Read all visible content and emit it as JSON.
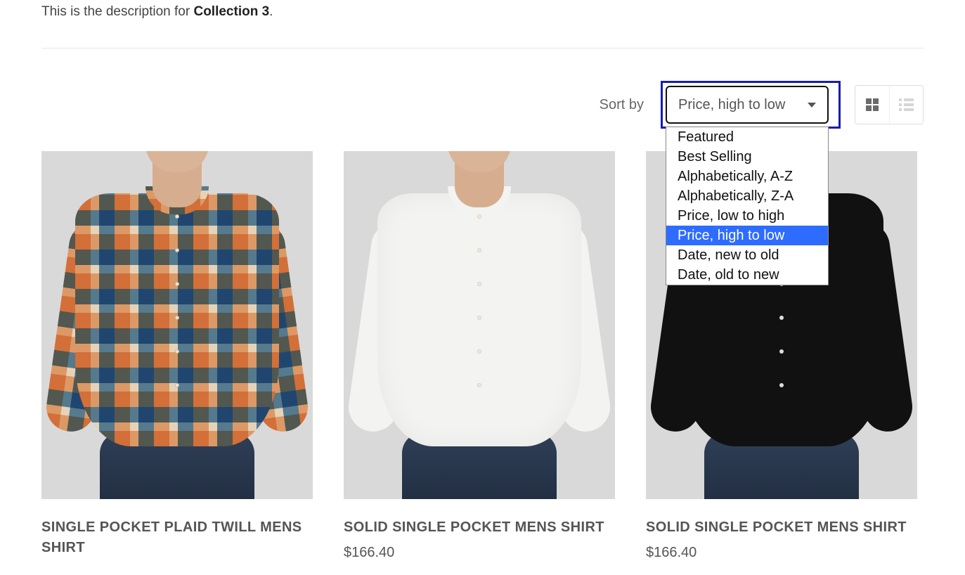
{
  "description_prefix": "This is the description for ",
  "description_bold": "Collection 3",
  "description_suffix": ".",
  "sort": {
    "label": "Sort by",
    "selected": "Price, high to low",
    "options": [
      "Featured",
      "Best Selling",
      "Alphabetically, A-Z",
      "Alphabetically, Z-A",
      "Price, low to high",
      "Price, high to low",
      "Date, new to old",
      "Date, old to new"
    ],
    "selected_index": 5
  },
  "view": {
    "grid_active": true
  },
  "products": [
    {
      "title": "SINGLE POCKET PLAID TWILL MENS SHIRT",
      "price": "",
      "variant": "plaid"
    },
    {
      "title": "SOLID SINGLE POCKET MENS SHIRT",
      "price": "$166.40",
      "variant": "white"
    },
    {
      "title": "SOLID SINGLE POCKET MENS SHIRT",
      "price": "$166.40",
      "variant": "black"
    }
  ]
}
